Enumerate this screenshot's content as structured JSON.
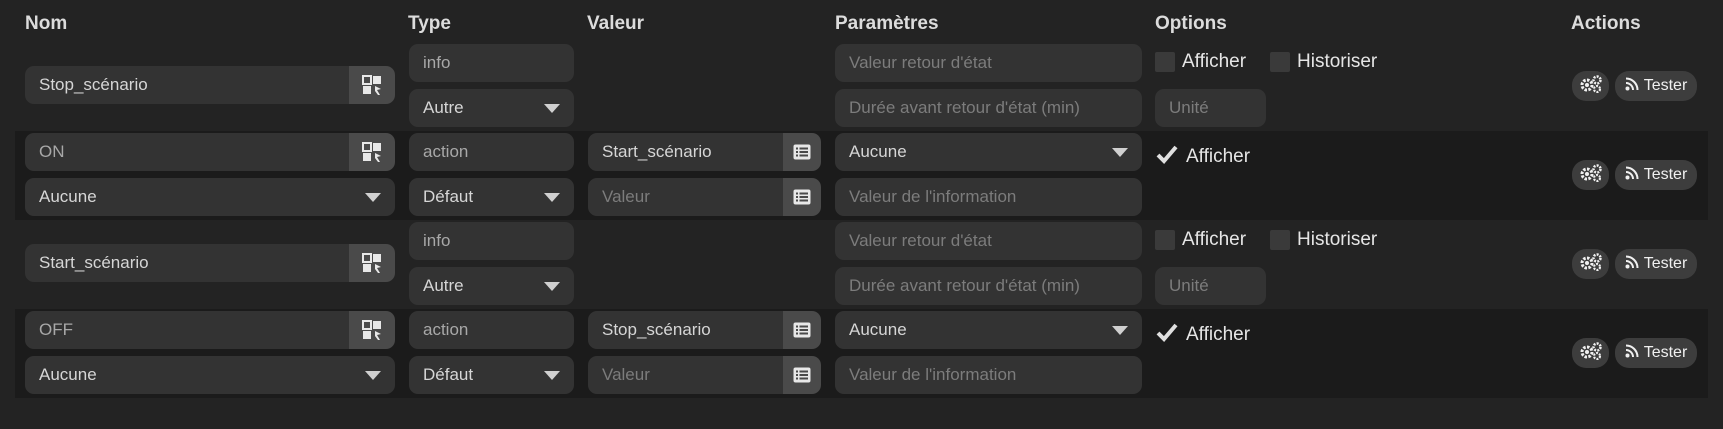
{
  "headers": {
    "nom": "Nom",
    "type": "Type",
    "valeur": "Valeur",
    "parametres": "Paramètres",
    "options": "Options",
    "actions": "Actions"
  },
  "rows": [
    {
      "name": "Stop_scénario",
      "type": "info",
      "subtype": "Autre",
      "param1_placeholder": "Valeur retour d'état",
      "param2_placeholder": "Durée avant retour d'état (min)",
      "opt_afficher": "Afficher",
      "opt_historiser": "Historiser",
      "unit_placeholder": "Unité",
      "test_label": "Tester"
    },
    {
      "name": "ON",
      "generic": "Aucune",
      "type": "action",
      "subtype": "Défaut",
      "value": "Start_scénario",
      "value_placeholder": "Valeur",
      "param_select": "Aucune",
      "param2_placeholder": "Valeur de l'information",
      "opt_afficher": "Afficher",
      "test_label": "Tester"
    },
    {
      "name": "Start_scénario",
      "type": "info",
      "subtype": "Autre",
      "param1_placeholder": "Valeur retour d'état",
      "param2_placeholder": "Durée avant retour d'état (min)",
      "opt_afficher": "Afficher",
      "opt_historiser": "Historiser",
      "unit_placeholder": "Unité",
      "test_label": "Tester"
    },
    {
      "name": "OFF",
      "generic": "Aucune",
      "type": "action",
      "subtype": "Défaut",
      "value": "Stop_scénario",
      "value_placeholder": "Valeur",
      "param_select": "Aucune",
      "param2_placeholder": "Valeur de l'information",
      "opt_afficher": "Afficher",
      "test_label": "Tester"
    }
  ],
  "icons": {
    "name_addon": "magic-icon",
    "value_addon": "list-icon",
    "config": "cogs-icon",
    "test": "rss-icon",
    "checked": "check-icon"
  }
}
